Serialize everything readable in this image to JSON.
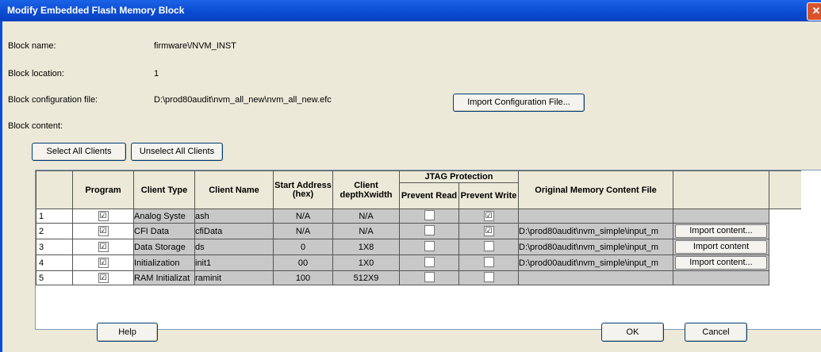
{
  "window": {
    "title": "Modify Embedded Flash Memory Block",
    "close": "✕"
  },
  "fields": {
    "block_name_label": "Block name:",
    "block_name_value": "firmware\\/NVM_INST",
    "block_location_label": "Block location:",
    "block_location_value": "1",
    "block_config_label": "Block configuration file:",
    "block_config_value": "D:\\prod80audit\\nvm_all_new\\nvm_all_new.efc",
    "block_content_label": "Block content:"
  },
  "buttons": {
    "import_config": "Import Configuration File...",
    "select_all": "Select All Clients",
    "unselect_all": "Unselect All Clients",
    "help": "Help",
    "ok": "OK",
    "cancel": "Cancel"
  },
  "table": {
    "headers": {
      "program": "Program",
      "client_type": "Client Type",
      "client_name": "Client Name",
      "start_address": "Start Address (hex)",
      "client_depth": "Client depthXwidth",
      "jtag": "JTAG Protection",
      "prevent_read": "Prevent Read",
      "prevent_write": "Prevent Write",
      "memory_file": "Original Memory Content File"
    },
    "rows": [
      {
        "num": "1",
        "program": "☑",
        "type": "Analog Syste",
        "name": "ash",
        "addr": "N/A",
        "depth": "N/A",
        "pr": "",
        "pw": "☑",
        "file": "",
        "action": ""
      },
      {
        "num": "2",
        "program": "☑",
        "type": "CFI Data",
        "name": "cfiData",
        "addr": "N/A",
        "depth": "N/A",
        "pr": "",
        "pw": "☑",
        "file": "D:\\prod80audit\\nvm_simple\\input_m",
        "action": "Import content..."
      },
      {
        "num": "3",
        "program": "☑",
        "type": "Data Storage",
        "name": "ds",
        "addr": "0",
        "depth": "1X8",
        "pr": "",
        "pw": "",
        "file": "D:\\prod80audit\\nvm_simple\\input_m",
        "action": "Import content"
      },
      {
        "num": "4",
        "program": "☑",
        "type": "Initialization",
        "name": "init1",
        "addr": "00",
        "depth": "1X0",
        "pr": "",
        "pw": "",
        "file": "D:\\prod00audit\\nvm_simple\\input_m",
        "action": "Import content..."
      },
      {
        "num": "5",
        "program": "☑",
        "type": "RAM Initializat",
        "name": "raminit",
        "addr": "100",
        "depth": "512X9",
        "pr": "",
        "pw": "",
        "file": "",
        "action": ""
      }
    ]
  }
}
